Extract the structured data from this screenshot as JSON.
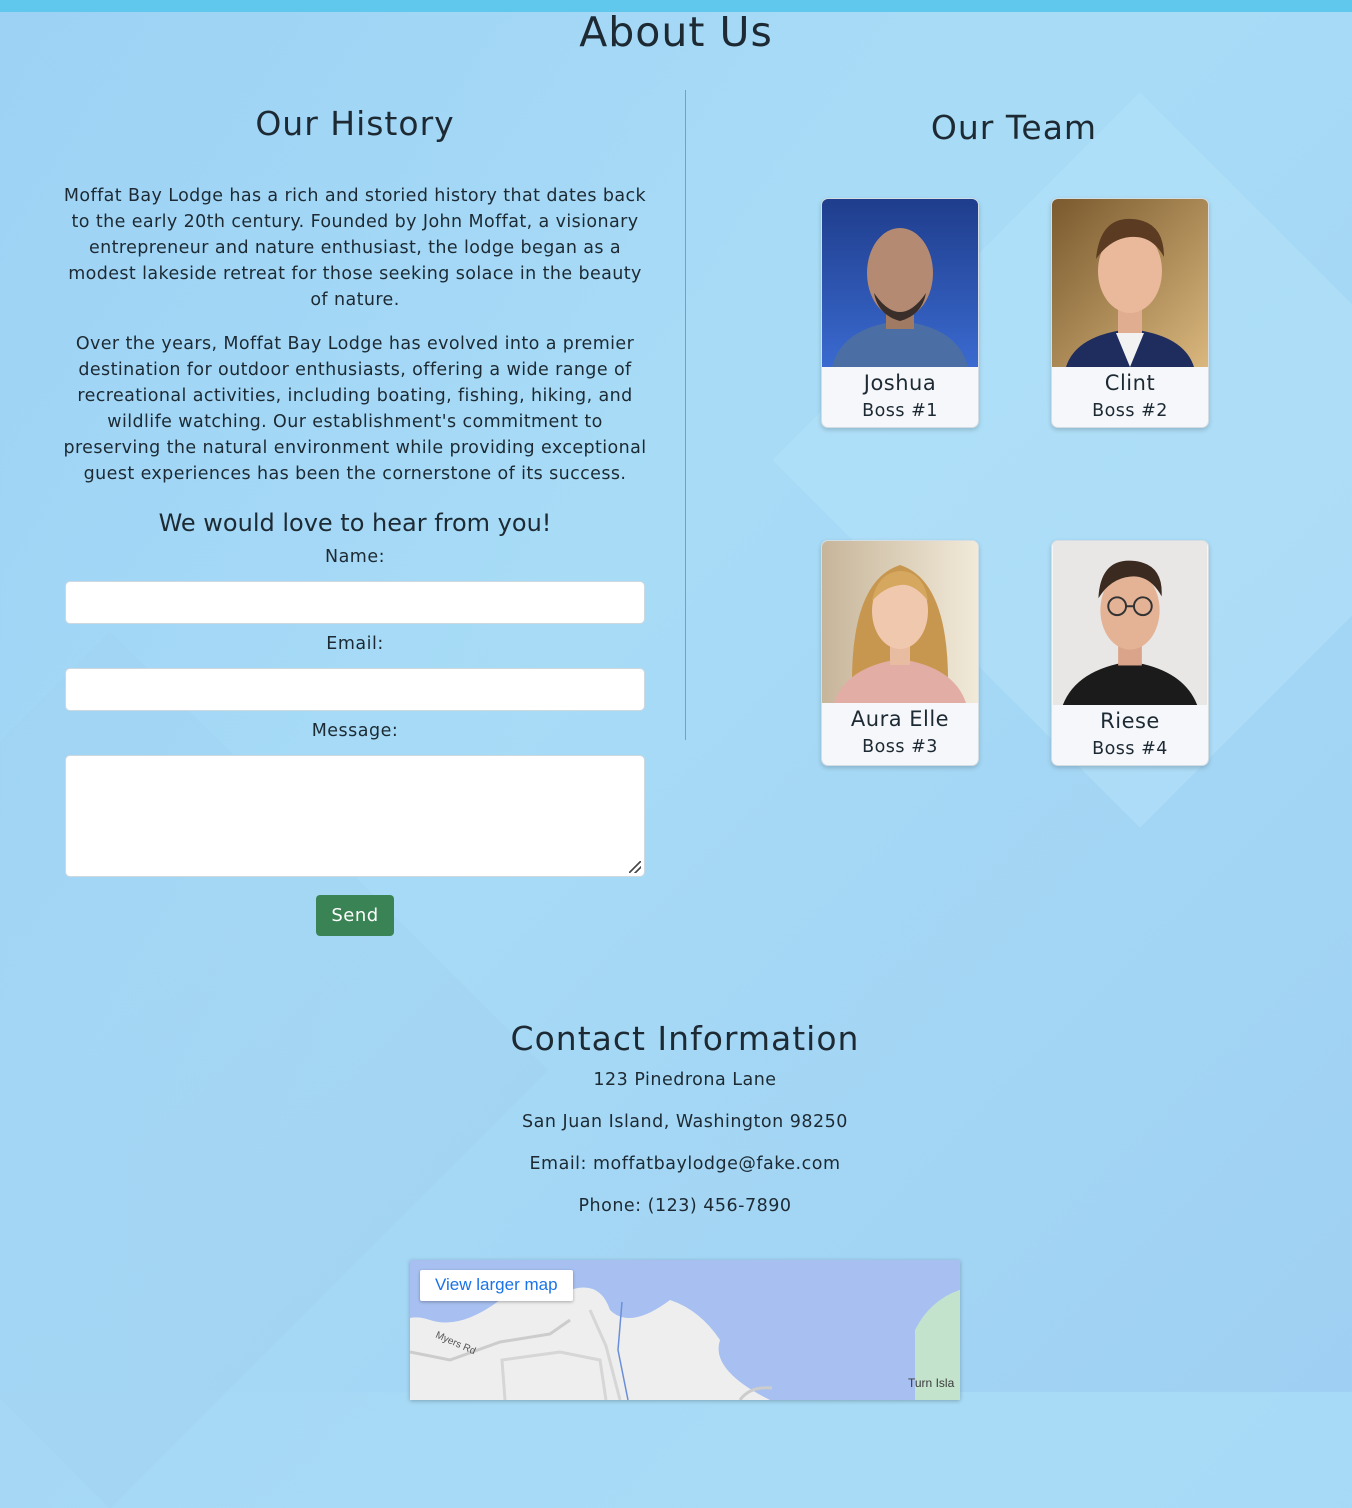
{
  "page": {
    "title": "About Us"
  },
  "history": {
    "title": "Our History",
    "paragraphs": [
      "Moffat Bay Lodge has a rich and storied history that dates back to the early 20th century. Founded by John Moffat, a visionary entrepreneur and nature enthusiast, the lodge began as a modest lakeside retreat for those seeking solace in the beauty of nature.",
      "Over the years, Moffat Bay Lodge has evolved into a premier destination for outdoor enthusiasts, offering a wide range of recreational activities, including boating, fishing, hiking, and wildlife watching. Our establishment's commitment to preserving the natural environment while providing exceptional guest experiences has been the cornerstone of its success."
    ]
  },
  "form": {
    "heading": "We would love to hear from you!",
    "name_label": "Name:",
    "name_value": "",
    "email_label": "Email:",
    "email_value": "",
    "message_label": "Message:",
    "message_value": "",
    "send_label": "Send",
    "send_color": "#3a8355"
  },
  "team": {
    "title": "Our Team",
    "members": [
      {
        "name": "Joshua",
        "role": "Boss #1"
      },
      {
        "name": "Clint",
        "role": "Boss #2"
      },
      {
        "name": "Aura Elle",
        "role": "Boss #3"
      },
      {
        "name": "Riese",
        "role": "Boss #4"
      }
    ]
  },
  "contact": {
    "title": "Contact Information",
    "address_line1": "123 Pinedrona Lane",
    "address_line2": "San Juan Island, Washington 98250",
    "email": "Email: moffatbaylodge@fake.com",
    "phone": "Phone: (123) 456-7890"
  },
  "map": {
    "link_label": "View larger map",
    "road_label": "Myers Rd",
    "place_label": "Turn Isla"
  },
  "colors": {
    "topbar": "#5fc8ec",
    "map_link": "#1a73e8"
  }
}
